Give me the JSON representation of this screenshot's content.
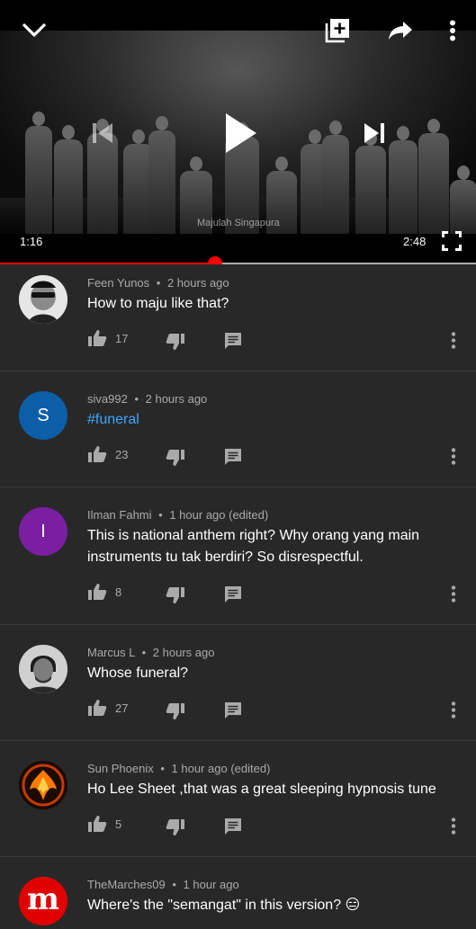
{
  "player": {
    "current_time": "1:16",
    "duration": "2:48",
    "progress_fraction": 0.452,
    "watermark": "Majulah Singapura",
    "icons": [
      "chevron-down-icon",
      "add-to-playlist-icon",
      "share-icon",
      "more-vert-icon",
      "previous-icon",
      "play-icon",
      "next-icon",
      "fullscreen-icon"
    ]
  },
  "comments": [
    {
      "author": "Feen Yunos",
      "time": "2 hours ago",
      "text": "How to maju like that?",
      "likes": "17",
      "avatar_letter": "",
      "avatar_color": "#d9d9d9"
    },
    {
      "author": "siva992",
      "time": "2 hours ago",
      "text": "#funeral",
      "likes": "23",
      "avatar_letter": "S",
      "avatar_color": "#0d5ea8"
    },
    {
      "author": "Ilman Fahmi",
      "time": "1 hour ago (edited)",
      "text": "This is national anthem right? Why orang yang main instruments tu tak berdiri? So disrespectful.",
      "likes": "8",
      "avatar_letter": "I",
      "avatar_color": "#7b1fa2"
    },
    {
      "author": "Marcus L",
      "time": "2 hours ago",
      "text": "Whose funeral?",
      "likes": "27",
      "avatar_letter": "",
      "avatar_color": "#cfcfcf"
    },
    {
      "author": "Sun Phoenix",
      "time": "1 hour ago (edited)",
      "text": "Ho Lee Sheet ,that was a great sleeping hypnosis tune",
      "likes": "5",
      "avatar_letter": "",
      "avatar_color": "#2a1200"
    },
    {
      "author": "TheMarches09",
      "time": "1 hour ago",
      "text": "Where's the \"semangat\" in this version? 😑",
      "likes": "",
      "avatar_letter": "m",
      "avatar_color": "#e10000"
    }
  ],
  "separator": "•",
  "colors": {
    "accent": "#ff0000",
    "link": "#3ea6ff",
    "background": "#282828"
  }
}
